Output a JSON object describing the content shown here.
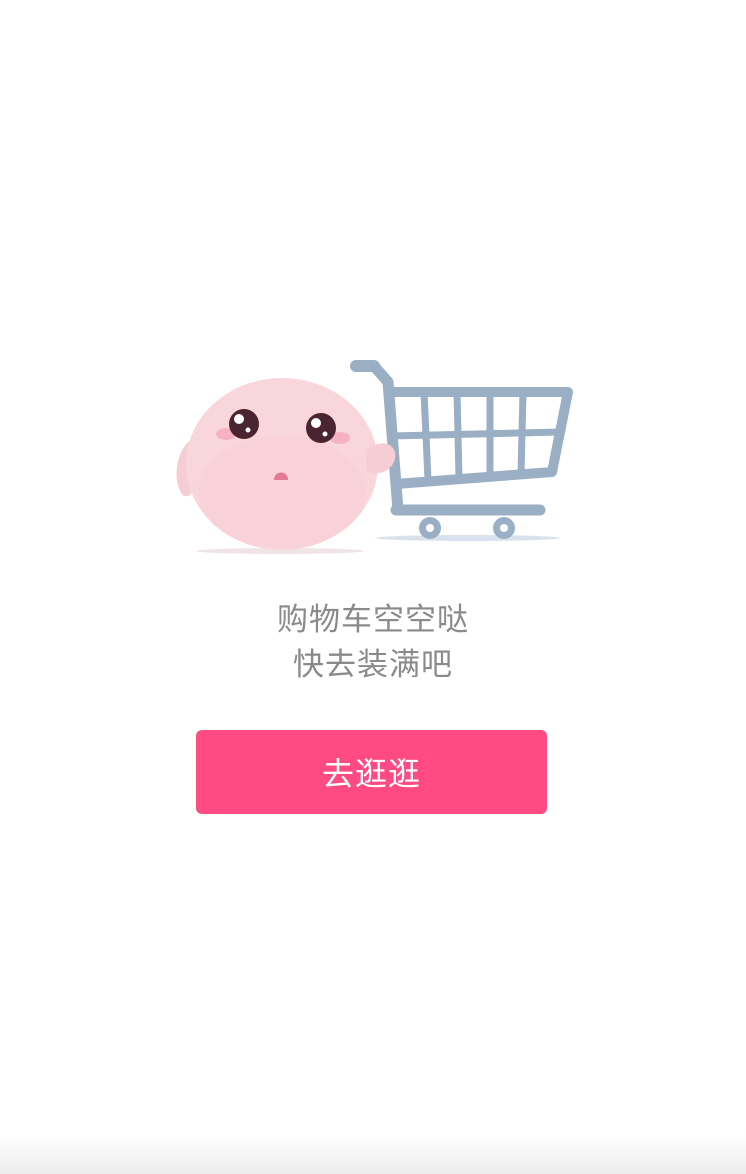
{
  "empty_cart": {
    "illustration_icon": "sad-blob-with-shopping-cart",
    "message_line1": "购物车空空哒",
    "message_line2": "快去装满吧",
    "action_label": "去逛逛"
  },
  "colors": {
    "background": "#ffffff",
    "message_text": "#8a8a8a",
    "button": "#ff4a83",
    "button_text": "#ffffff",
    "blob": "#f9d6dc",
    "cart": "#9aafc4"
  }
}
